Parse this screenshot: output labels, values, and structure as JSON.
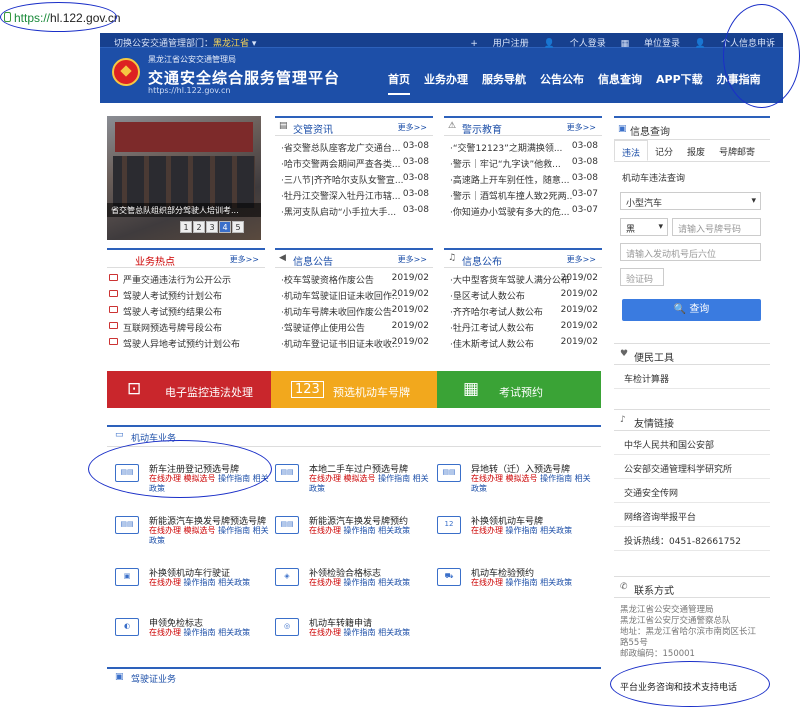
{
  "browser": {
    "secure": "https://",
    "host": "hl.122.gov.cn"
  },
  "header": {
    "region_prefix": "切换公安交通管理部门：",
    "region": "黑龙江省",
    "top_links": [
      "用户注册",
      "个人登录",
      "单位登录",
      "个人信息申诉"
    ],
    "org": "黑龙江省公安交通管理局",
    "title": "交通安全综合服务管理平台",
    "site": "https://hl.122.gov.cn",
    "nav": [
      "首页",
      "业务办理",
      "服务导航",
      "公告公布",
      "信息查询",
      "APP下载",
      "办事指南"
    ]
  },
  "banner": {
    "caption": "省交管总队组织部分驾驶人培训考...",
    "pages": [
      "1",
      "2",
      "3",
      "4",
      "5"
    ],
    "active_page": "4"
  },
  "news": {
    "title": "交管资讯",
    "more": "更多>>",
    "items": [
      {
        "t": "·省交警总队座客龙广交通台...",
        "d": "03-08"
      },
      {
        "t": "·哈市交警两会期间严查各类...",
        "d": "03-08"
      },
      {
        "t": "·三八节|齐齐哈尔支队女警宣...",
        "d": "03-08"
      },
      {
        "t": "·牡丹江交警深入牡丹江市辖...",
        "d": "03-08"
      },
      {
        "t": "·黑河支队启动“小手拉大手...",
        "d": "03-08"
      }
    ]
  },
  "warning": {
    "title": "警示教育",
    "more": "更多>>",
    "items": [
      {
        "t": "·“交警12123”之期满换领...",
        "d": "03-08"
      },
      {
        "t": "·警示｜牢记“九字诀”他救...",
        "d": "03-08"
      },
      {
        "t": "·高速路上开车别任性，随意...",
        "d": "03-08"
      },
      {
        "t": "·警示｜酒驾机车撞人致2死两...",
        "d": "03-07"
      },
      {
        "t": "·你知道办小驾驶有多大的危...",
        "d": "03-07"
      }
    ]
  },
  "hot": {
    "title": "业务热点",
    "more": "更多>>",
    "items": [
      "严重交通违法行为公开公示",
      "驾驶人考试预约计划公布",
      "驾驶人考试预约结果公布",
      "互联网预选号牌号段公布",
      "驾驶人异地考试预约计划公布"
    ]
  },
  "notice": {
    "title": "信息公告",
    "more": "更多>>",
    "items": [
      {
        "t": "·校车驾驶资格作废公告",
        "d": "2019/02"
      },
      {
        "t": "·机动车驾驶证旧证未收回作...",
        "d": "2019/02"
      },
      {
        "t": "·机动车号牌未收回作废公告",
        "d": "2019/02"
      },
      {
        "t": "·驾驶证停止使用公告",
        "d": "2019/02"
      },
      {
        "t": "·机动车登记证书旧证未收收...",
        "d": "2019/02"
      }
    ]
  },
  "exam": {
    "title": "信息公布",
    "more": "更多>>",
    "items": [
      {
        "t": "·大中型客货车驾驶人满分公布",
        "d": "2019/02"
      },
      {
        "t": "·垦区考试人数公布",
        "d": "2019/02"
      },
      {
        "t": "·齐齐哈尔考试人数公布",
        "d": "2019/02"
      },
      {
        "t": "·牡丹江考试人数公布",
        "d": "2019/02"
      },
      {
        "t": "·佳木斯考试人数公布",
        "d": "2019/02"
      }
    ]
  },
  "services": [
    {
      "label": "电子监控违法处理",
      "color": "#c9262c"
    },
    {
      "label": "预选机动车号牌",
      "color": "#f2a81d"
    },
    {
      "label": "考试预约",
      "color": "#3aa336"
    }
  ],
  "query": {
    "title": "信息查询",
    "tabs": [
      "违法",
      "记分",
      "报废",
      "号牌邮寄"
    ],
    "sub": "机动车违法查询",
    "vehicle_type": "小型汽车",
    "province": "黑",
    "plate_ph": "请输入号牌号码",
    "engine_ph": "请输入发动机号后六位",
    "captcha_ph": "验证码",
    "button": "查询"
  },
  "convenience": {
    "title": "便民工具",
    "items": [
      "车检计算器"
    ]
  },
  "links": {
    "title": "友情链接",
    "items": [
      "中华人民共和国公安部",
      "公安部交通管理科学研究所",
      "交通安全传网",
      "网络咨询举报平台",
      "投诉热线：0451-82661752"
    ]
  },
  "contact": {
    "title": "联系方式",
    "lines": [
      "黑龙江省公安交通管理局",
      "黑龙江省公安厅交通警察总队",
      "地址：黑龙江省哈尔滨市南岗区长江",
      "路55号",
      "邮政编码：150001"
    ],
    "hotline": "平台业务咨询和技术支持电话"
  },
  "vehicle": {
    "title": "机动车业务",
    "items": [
      {
        "name": "新车注册登记预选号牌",
        "ico": "▤▤",
        "acts": [
          {
            "t": "在线办理",
            "c": "r"
          },
          {
            "t": "模拟选号",
            "c": "r"
          },
          {
            "t": "操作指南",
            "c": "b"
          },
          {
            "t": "相关政策",
            "c": "b"
          }
        ]
      },
      {
        "name": "本地二手车过户预选号牌",
        "ico": "▤▤",
        "acts": [
          {
            "t": "在线办理",
            "c": "r"
          },
          {
            "t": "模拟选号",
            "c": "r"
          },
          {
            "t": "操作指南",
            "c": "b"
          },
          {
            "t": "相关政策",
            "c": "b"
          }
        ]
      },
      {
        "name": "异地转（迁）入预选号牌",
        "ico": "▤▤",
        "acts": [
          {
            "t": "在线办理",
            "c": "r"
          },
          {
            "t": "模拟选号",
            "c": "r"
          },
          {
            "t": "操作指南",
            "c": "b"
          },
          {
            "t": "相关政策",
            "c": "b"
          }
        ]
      },
      {
        "name": "新能源汽车换发号牌预选号牌",
        "ico": "▤▤",
        "acts": [
          {
            "t": "在线办理",
            "c": "r"
          },
          {
            "t": "模拟选号",
            "c": "r"
          },
          {
            "t": "操作指南",
            "c": "b"
          },
          {
            "t": "相关政策",
            "c": "b"
          }
        ]
      },
      {
        "name": "新能源汽车换发号牌预约",
        "ico": "▤▤",
        "acts": [
          {
            "t": "在线办理",
            "c": "r"
          },
          {
            "t": "操作指南",
            "c": "b"
          },
          {
            "t": "相关政策",
            "c": "b"
          }
        ]
      },
      {
        "name": "补换领机动车号牌",
        "ico": "12",
        "acts": [
          {
            "t": "在线办理",
            "c": "r"
          },
          {
            "t": "操作指南",
            "c": "b"
          },
          {
            "t": "相关政策",
            "c": "b"
          }
        ]
      },
      {
        "name": "补换领机动车行驶证",
        "ico": "▣",
        "acts": [
          {
            "t": "在线办理",
            "c": "r"
          },
          {
            "t": "操作指南",
            "c": "b"
          },
          {
            "t": "相关政策",
            "c": "b"
          }
        ]
      },
      {
        "name": "补领检验合格标志",
        "ico": "◈",
        "acts": [
          {
            "t": "在线办理",
            "c": "r"
          },
          {
            "t": "操作指南",
            "c": "b"
          },
          {
            "t": "相关政策",
            "c": "b"
          }
        ]
      },
      {
        "name": "机动车检验预约",
        "ico": "⛟",
        "acts": [
          {
            "t": "在线办理",
            "c": "r"
          },
          {
            "t": "操作指南",
            "c": "b"
          },
          {
            "t": "相关政策",
            "c": "b"
          }
        ]
      },
      {
        "name": "申领免检标志",
        "ico": "◐",
        "acts": [
          {
            "t": "在线办理",
            "c": "r"
          },
          {
            "t": "操作指南",
            "c": "b"
          },
          {
            "t": "相关政策",
            "c": "b"
          }
        ]
      },
      {
        "name": "机动车转籍申请",
        "ico": "◎",
        "acts": [
          {
            "t": "在线办理",
            "c": "r"
          },
          {
            "t": "操作指南",
            "c": "b"
          },
          {
            "t": "相关政策",
            "c": "b"
          }
        ]
      }
    ]
  },
  "license": {
    "title": "驾驶证业务"
  }
}
